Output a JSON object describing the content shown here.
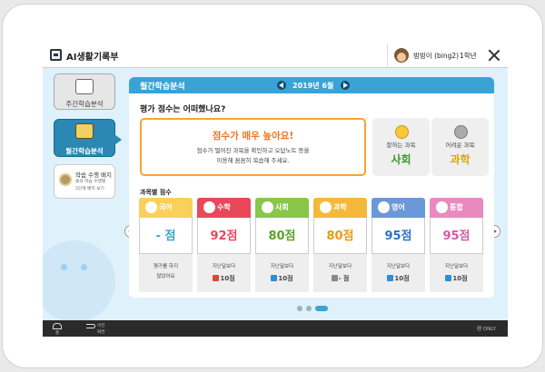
{
  "app": {
    "title": "AI생활기록부",
    "user": "빙빙이 (bing2)",
    "grade": "1학년"
  },
  "sidebar": {
    "items": [
      {
        "label": "주간학습분석"
      },
      {
        "label": "월간학습분석"
      },
      {
        "label": "학습 수행 배지",
        "line2": "출석 학습 수행별",
        "line3": "5단계 배지 보기"
      }
    ]
  },
  "panel": {
    "title": "월간학습분석",
    "month": "2019년 6월",
    "question": "평가 점수는 어떠했나요?",
    "message": {
      "headline": "점수가 매우 높아요!",
      "line1": "점수가 떨어진 과목을 확인하고 오답노트 등을",
      "line2": "이용해 꼼꼼히 복습해 주세요."
    },
    "good_subject": {
      "caption": "잘하는 과목",
      "name": "사회"
    },
    "weak_subject": {
      "caption": "어려운 과목",
      "name": "과학"
    },
    "grade_label": "과목별 점수",
    "subjects": [
      {
        "name": "국어",
        "score": "- 점",
        "compare_label": "평가를 하지",
        "compare_value": "않았어요",
        "trend": "none"
      },
      {
        "name": "수학",
        "score": "92점",
        "compare_label": "지난달보다",
        "compare_value": "10점",
        "trend": "up"
      },
      {
        "name": "사회",
        "score": "80점",
        "compare_label": "지난달보다",
        "compare_value": "10점",
        "trend": "down"
      },
      {
        "name": "과학",
        "score": "80점",
        "compare_label": "지난달보다",
        "compare_value": "- 점",
        "trend": "flat"
      },
      {
        "name": "영어",
        "score": "95점",
        "compare_label": "지난달보다",
        "compare_value": "10점",
        "trend": "down"
      },
      {
        "name": "통합",
        "score": "95점",
        "compare_label": "지난달보다",
        "compare_value": "10점",
        "trend": "down"
      }
    ]
  },
  "bottom": {
    "home": "홈",
    "back_line1": "이전",
    "back_line2": "화면",
    "pen": "펜 ONLY"
  },
  "colors": {
    "accent": "#3aa3d6",
    "warn": "#f37321"
  }
}
